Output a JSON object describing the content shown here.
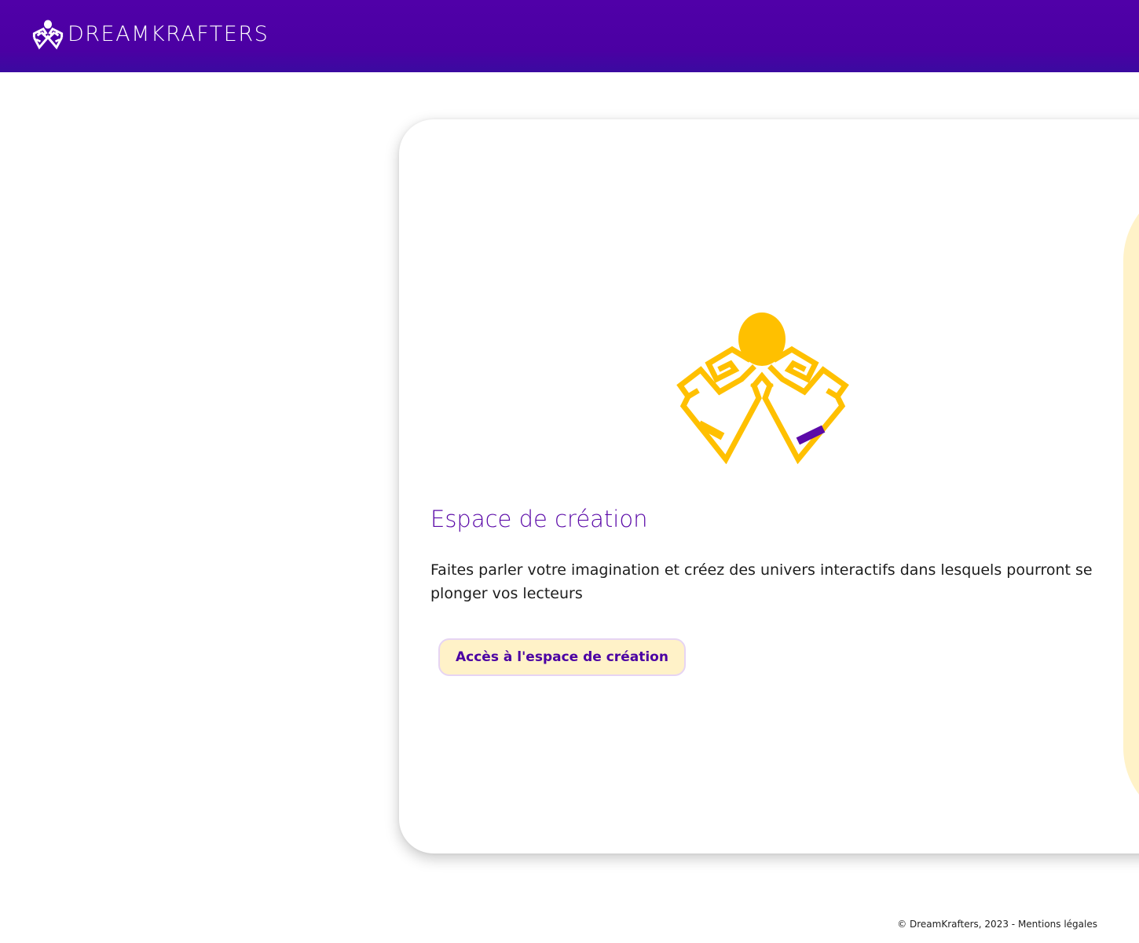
{
  "header": {
    "brand_name": "DREAMKRAFTERS",
    "logo_icon": "octopus-logo-icon",
    "background_color": "#4b00a3"
  },
  "main": {
    "card": {
      "illustration_icon": "octopus-mascot-icon",
      "title": "Espace de création",
      "description": "Faites parler votre imagination et créez des univers interactifs dans lesquels pourront se plonger vos lecteurs",
      "button_label": "Accès à l'espace de création"
    }
  },
  "footer": {
    "copyright": "© DreamKrafters, 2023 - ",
    "legal_link": "Mentions légales"
  },
  "colors": {
    "primary_purple": "#4b00a3",
    "accent_yellow": "#ffc000",
    "button_bg": "#fff2c8"
  }
}
